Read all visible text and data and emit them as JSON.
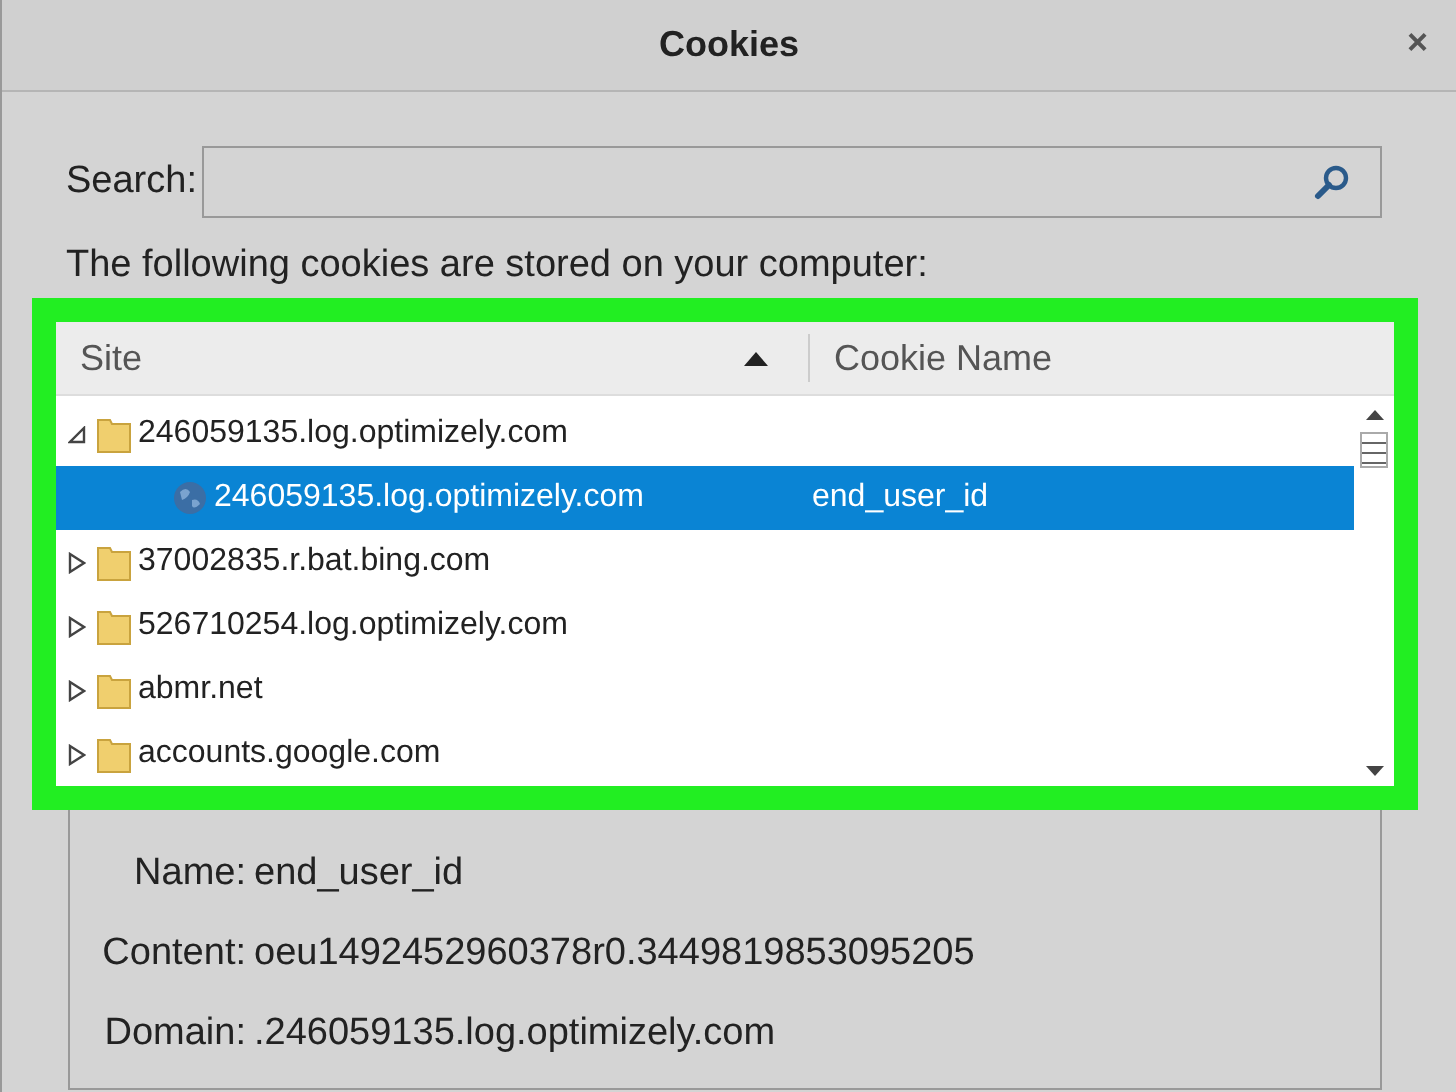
{
  "window": {
    "title": "Cookies",
    "close": "×"
  },
  "search": {
    "label": "Search:"
  },
  "intro": "The following cookies are stored on your computer:",
  "tree": {
    "columns": [
      {
        "label": "Site",
        "sorted": true
      },
      {
        "label": "Cookie Name",
        "sorted": false
      }
    ],
    "items": [
      {
        "kind": "folder",
        "site": "246059135.log.optimizely.com",
        "expanded": true,
        "selected": false,
        "children": [
          {
            "kind": "cookie",
            "site": "246059135.log.optimizely.com",
            "cookie_name": "end_user_id",
            "selected": true
          }
        ]
      },
      {
        "kind": "folder",
        "site": "37002835.r.bat.bing.com",
        "expanded": false,
        "selected": false
      },
      {
        "kind": "folder",
        "site": "526710254.log.optimizely.com",
        "expanded": false,
        "selected": false
      },
      {
        "kind": "folder",
        "site": "abmr.net",
        "expanded": false,
        "selected": false
      },
      {
        "kind": "folder",
        "site": "accounts.google.com",
        "expanded": false,
        "selected": false
      }
    ]
  },
  "details": [
    {
      "label": "Name:",
      "value": "end_user_id"
    },
    {
      "label": "Content:",
      "value": "oeu1492452960378r0.3449819853095205"
    },
    {
      "label": "Domain:",
      "value": ".246059135.log.optimizely.com"
    }
  ]
}
